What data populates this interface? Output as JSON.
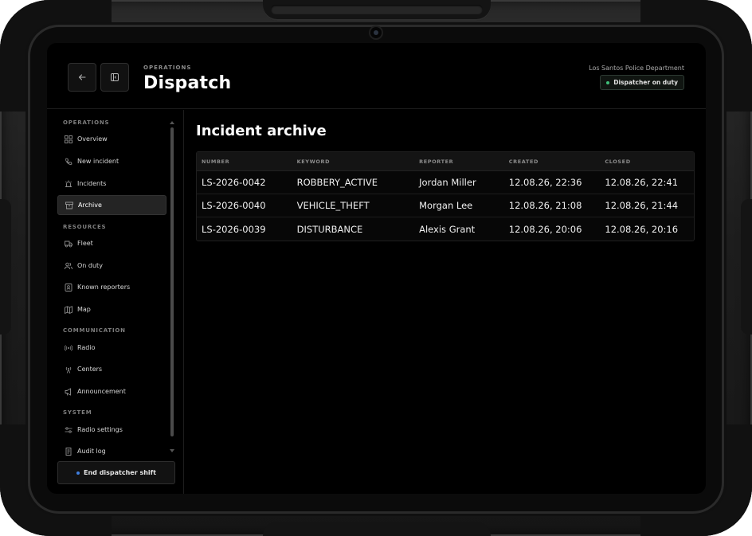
{
  "header": {
    "eyebrow": "OPERATIONS",
    "title": "Dispatch",
    "department": "Los Santos Police Department",
    "status_badge": "Dispatcher on duty",
    "status_color": "#3fbf7a"
  },
  "sidebar": {
    "sections": [
      {
        "label": "OPERATIONS",
        "items": [
          {
            "label": "Overview",
            "icon": "grid-icon"
          },
          {
            "label": "New incident",
            "icon": "phone-icon"
          },
          {
            "label": "Incidents",
            "icon": "siren-icon"
          },
          {
            "label": "Archive",
            "icon": "archive-icon",
            "active": true
          }
        ]
      },
      {
        "label": "RESOURCES",
        "items": [
          {
            "label": "Fleet",
            "icon": "truck-icon"
          },
          {
            "label": "On duty",
            "icon": "users-icon"
          },
          {
            "label": "Known reporters",
            "icon": "contact-icon"
          },
          {
            "label": "Map",
            "icon": "map-icon"
          }
        ]
      },
      {
        "label": "COMMUNICATION",
        "items": [
          {
            "label": "Radio",
            "icon": "radio-icon"
          },
          {
            "label": "Centers",
            "icon": "antenna-icon"
          },
          {
            "label": "Announcement",
            "icon": "megaphone-icon"
          }
        ]
      },
      {
        "label": "SYSTEM",
        "items": [
          {
            "label": "Radio settings",
            "icon": "sliders-icon"
          },
          {
            "label": "Audit log",
            "icon": "log-icon"
          }
        ]
      }
    ],
    "end_shift_label": "End dispatcher shift",
    "end_shift_color": "#3f7fe0"
  },
  "main": {
    "title": "Incident archive",
    "columns": [
      "NUMBER",
      "KEYWORD",
      "REPORTER",
      "CREATED",
      "CLOSED"
    ],
    "rows": [
      [
        "LS-2026-0042",
        "ROBBERY_ACTIVE",
        "Jordan Miller",
        "12.08.26, 22:36",
        "12.08.26, 22:41"
      ],
      [
        "LS-2026-0040",
        "VEHICLE_THEFT",
        "Morgan Lee",
        "12.08.26, 21:08",
        "12.08.26, 21:44"
      ],
      [
        "LS-2026-0039",
        "DISTURBANCE",
        "Alexis Grant",
        "12.08.26, 20:06",
        "12.08.26, 20:16"
      ]
    ]
  }
}
